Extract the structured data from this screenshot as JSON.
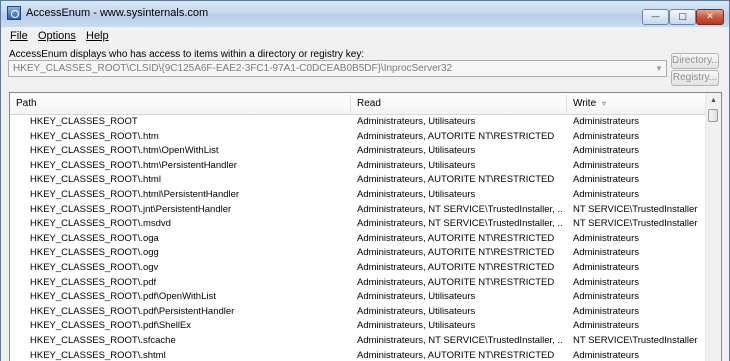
{
  "window": {
    "title": "AccessEnum - www.sysinternals.com",
    "icon": "app-icon",
    "controls": {
      "minimize": "—",
      "maximize": "□",
      "close": "✕"
    }
  },
  "menu": [
    {
      "label": "File"
    },
    {
      "label": "Options"
    },
    {
      "label": "Help"
    }
  ],
  "description": "AccessEnum displays who has access to items within a directory or registry key:",
  "path_value": "HKEY_CLASSES_ROOT\\CLSID\\{9C125A6F-EAE2-3FC1-97A1-C0DCEAB0B5DF}\\InprocServer32",
  "buttons": {
    "directory": "Directory...",
    "registry": "Registry..."
  },
  "table": {
    "columns": {
      "path": "Path",
      "read": "Read",
      "write": "Write"
    },
    "rows": [
      {
        "path": "HKEY_CLASSES_ROOT",
        "read": "Administrateurs, Utilisateurs",
        "write": "Administrateurs"
      },
      {
        "path": "HKEY_CLASSES_ROOT\\.htm",
        "read": "Administrateurs, AUTORITE NT\\RESTRICTED",
        "write": "Administrateurs"
      },
      {
        "path": "HKEY_CLASSES_ROOT\\.htm\\OpenWithList",
        "read": "Administrateurs, Utilisateurs",
        "write": "Administrateurs"
      },
      {
        "path": "HKEY_CLASSES_ROOT\\.htm\\PersistentHandler",
        "read": "Administrateurs, Utilisateurs",
        "write": "Administrateurs"
      },
      {
        "path": "HKEY_CLASSES_ROOT\\.html",
        "read": "Administrateurs, AUTORITE NT\\RESTRICTED",
        "write": "Administrateurs"
      },
      {
        "path": "HKEY_CLASSES_ROOT\\.html\\PersistentHandler",
        "read": "Administrateurs, Utilisateurs",
        "write": "Administrateurs"
      },
      {
        "path": "HKEY_CLASSES_ROOT\\.jnt\\PersistentHandler",
        "read": "Administrateurs, NT SERVICE\\TrustedInstaller, ...",
        "write": "NT SERVICE\\TrustedInstaller"
      },
      {
        "path": "HKEY_CLASSES_ROOT\\.msdvd",
        "read": "Administrateurs, NT SERVICE\\TrustedInstaller, ...",
        "write": "NT SERVICE\\TrustedInstaller"
      },
      {
        "path": "HKEY_CLASSES_ROOT\\.oga",
        "read": "Administrateurs, AUTORITE NT\\RESTRICTED",
        "write": "Administrateurs"
      },
      {
        "path": "HKEY_CLASSES_ROOT\\.ogg",
        "read": "Administrateurs, AUTORITE NT\\RESTRICTED",
        "write": "Administrateurs"
      },
      {
        "path": "HKEY_CLASSES_ROOT\\.ogv",
        "read": "Administrateurs, AUTORITE NT\\RESTRICTED",
        "write": "Administrateurs"
      },
      {
        "path": "HKEY_CLASSES_ROOT\\.pdf",
        "read": "Administrateurs, AUTORITE NT\\RESTRICTED",
        "write": "Administrateurs"
      },
      {
        "path": "HKEY_CLASSES_ROOT\\.pdf\\OpenWithList",
        "read": "Administrateurs, Utilisateurs",
        "write": "Administrateurs"
      },
      {
        "path": "HKEY_CLASSES_ROOT\\.pdf\\PersistentHandler",
        "read": "Administrateurs, Utilisateurs",
        "write": "Administrateurs"
      },
      {
        "path": "HKEY_CLASSES_ROOT\\.pdf\\ShellEx",
        "read": "Administrateurs, Utilisateurs",
        "write": "Administrateurs"
      },
      {
        "path": "HKEY_CLASSES_ROOT\\.sfcache",
        "read": "Administrateurs, NT SERVICE\\TrustedInstaller, ...",
        "write": "NT SERVICE\\TrustedInstaller"
      },
      {
        "path": "HKEY_CLASSES_ROOT\\.shtml",
        "read": "Administrateurs, AUTORITE NT\\RESTRICTED",
        "write": "Administrateurs"
      }
    ]
  }
}
